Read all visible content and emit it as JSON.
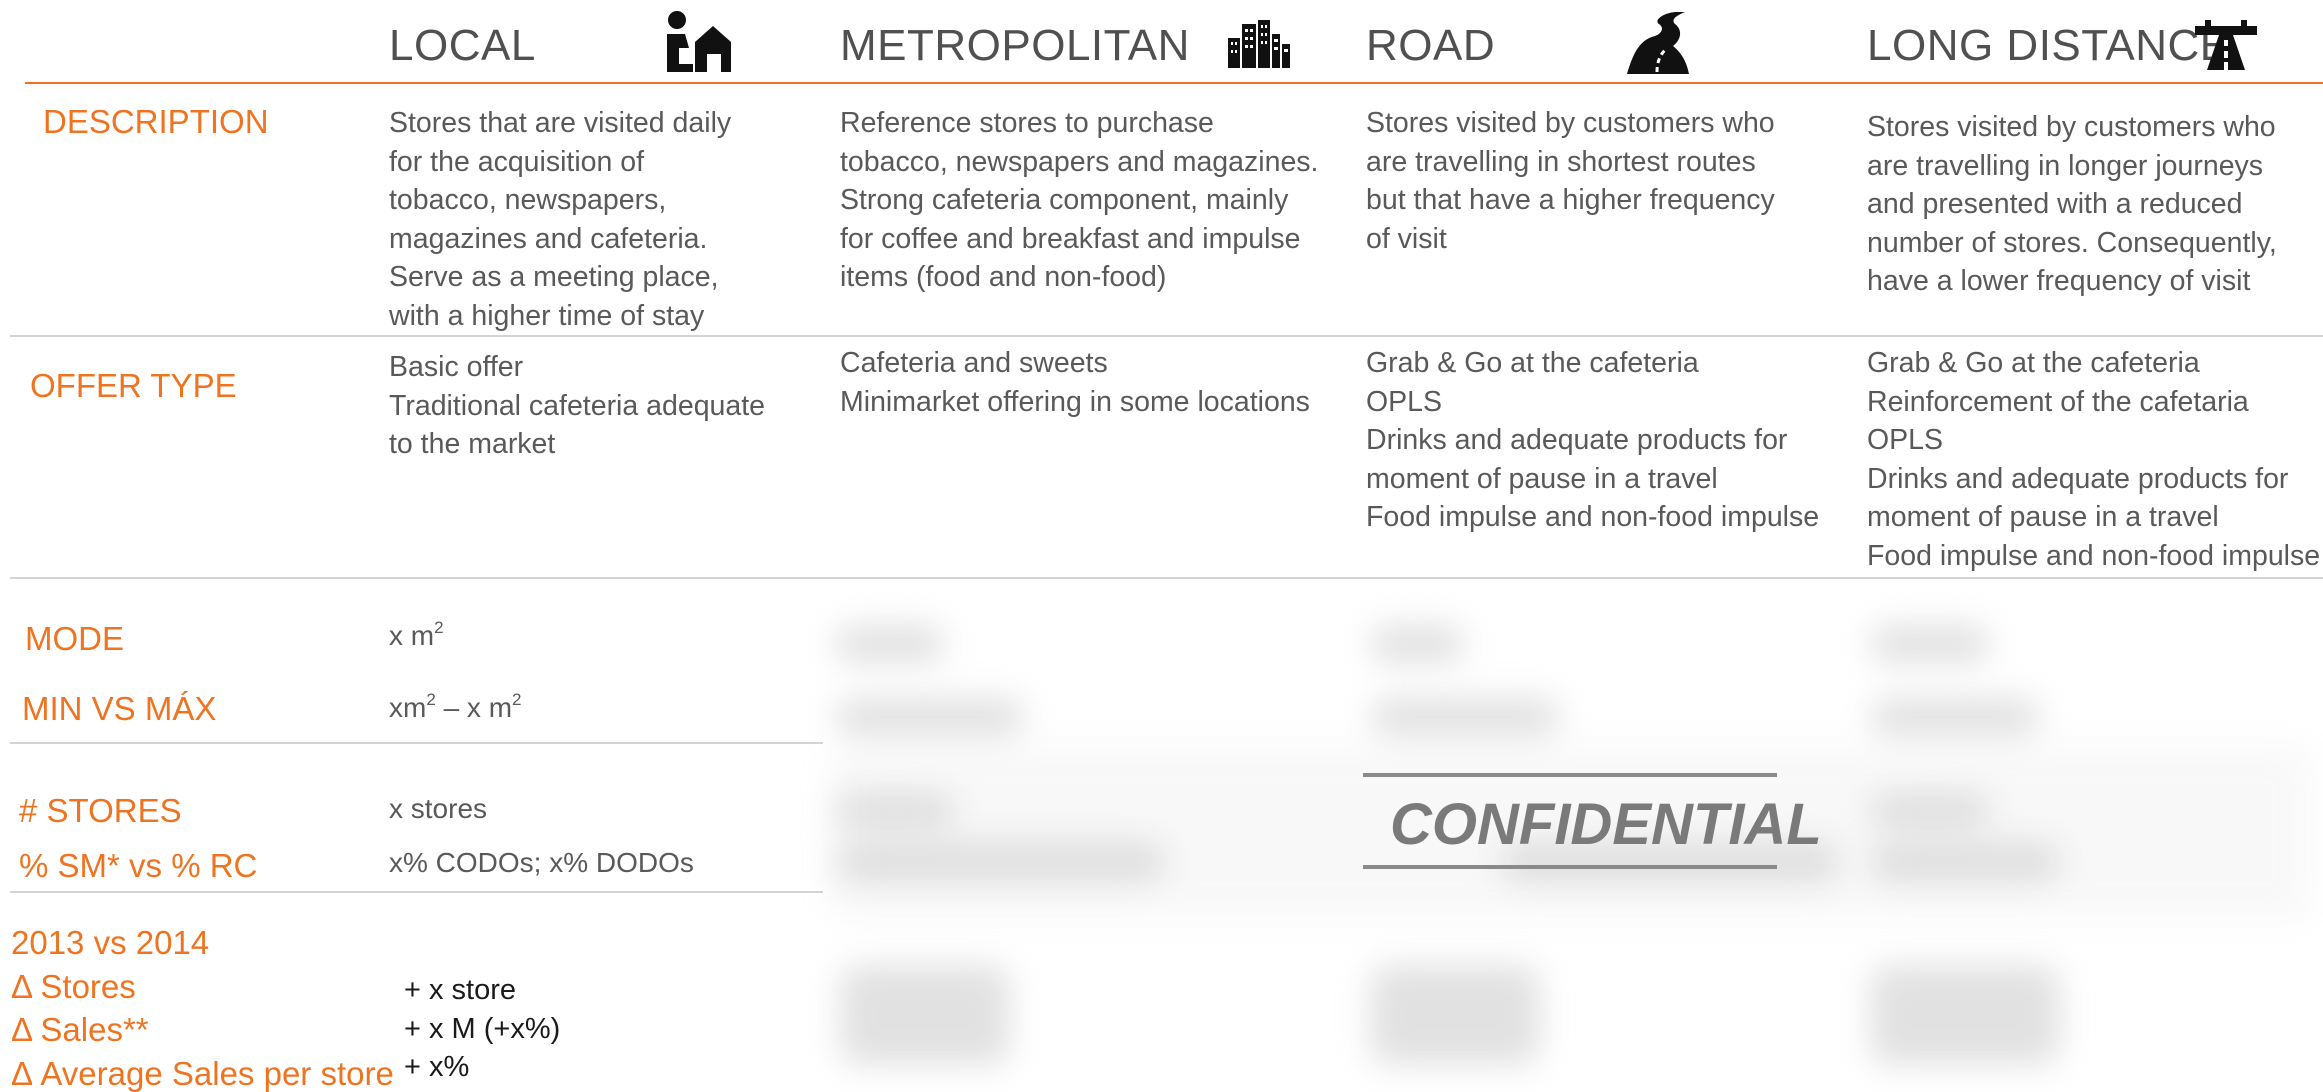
{
  "columns": [
    {
      "title": "LOCAL",
      "icon": "person-house-icon"
    },
    {
      "title": "METROPOLITAN",
      "icon": "city-buildings-icon"
    },
    {
      "title": "ROAD",
      "icon": "winding-road-icon"
    },
    {
      "title": "LONG DISTANCE",
      "icon": "highway-icon"
    }
  ],
  "rows": {
    "description": "DESCRIPTION",
    "offer_type": "OFFER TYPE",
    "mode": "MODE",
    "min_vs_max": "MIN VS MÁX",
    "stores": "# STORES",
    "sm_vs_rc": "% SM* vs % RC",
    "years": "2013 vs 2014",
    "delta_stores": "Δ Stores",
    "delta_sales": "Δ Sales**",
    "delta_avg": "Δ Average Sales per store"
  },
  "description": {
    "local": [
      "Stores that are visited daily",
      "for the acquisition of",
      "tobacco, newspapers,",
      "magazines and cafeteria.",
      "Serve as a meeting place,",
      "with a higher time of stay"
    ],
    "metropolitan": [
      "Reference stores to purchase",
      "tobacco, newspapers and magazines.",
      "Strong cafeteria component, mainly",
      "for coffee and breakfast and impulse",
      "items (food and non-food)"
    ],
    "road": [
      "Stores visited by customers who",
      "are travelling in shortest routes",
      "but that have a higher frequency",
      "of visit"
    ],
    "long_distance": [
      "Stores visited by customers who",
      "are travelling in longer journeys",
      "and presented with a reduced",
      "number of stores. Consequently,",
      "have a lower frequency of visit"
    ]
  },
  "offer_type": {
    "local": [
      "Basic offer",
      "Traditional cafeteria adequate",
      "to the market"
    ],
    "metropolitan": [
      "Cafeteria and sweets",
      "Minimarket offering in some locations"
    ],
    "road": [
      "Grab & Go at the cafeteria",
      "OPLS",
      "Drinks and adequate products for",
      "moment of pause in a travel",
      "Food impulse and non-food impulse"
    ],
    "long_distance": [
      "Grab & Go at the cafeteria",
      "Reinforcement of the cafetaria",
      "OPLS",
      "Drinks and adequate products for",
      "moment of pause in a travel",
      "Food impulse and non-food impulse"
    ]
  },
  "local_values": {
    "mode_prefix": "x m",
    "mode_exp": "2",
    "minmax_a": "xm",
    "minmax_exp_a": "2",
    "minmax_mid": " – x m",
    "minmax_exp_b": "2",
    "stores": "x stores",
    "sm_rc": "x% CODOs; x% DODOs",
    "delta_stores": "+ x store",
    "delta_sales": "+ x M (+x%)",
    "delta_avg": "+ x%"
  },
  "stamp": "CONFIDENTIAL",
  "colors": {
    "accent": "#ee7421",
    "text": "#595959",
    "rule": "#cfcfcf"
  }
}
